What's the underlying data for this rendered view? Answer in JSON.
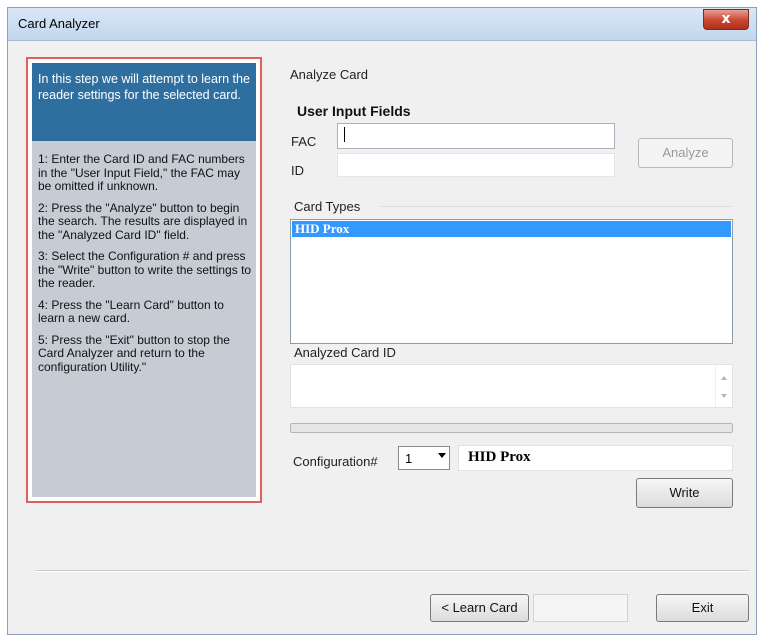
{
  "window": {
    "title": "Card Analyzer",
    "close_glyph": "x"
  },
  "help": {
    "intro": "In this step we will attempt to learn the reader settings for the selected card.",
    "steps": [
      "1: Enter the Card ID and FAC numbers in the \"User Input Field,\" the FAC may be omitted if unknown.",
      "2: Press the \"Analyze\" button to begin the search. The results are displayed in the \"Analyzed Card ID\" field.",
      "3: Select the Configuration # and press the \"Write\" button to write the settings to the reader.",
      "4: Press the \"Learn Card\" button to learn a new card.",
      "5: Press the \"Exit\" button to stop the Card Analyzer and return to the configuration Utility.\""
    ]
  },
  "main": {
    "section_title": "Analyze Card",
    "user_input_title": "User Input Fields",
    "fac_label": "FAC",
    "fac_value": "",
    "id_label": "ID",
    "id_value": "",
    "analyze_button": "Analyze",
    "card_types_label": "Card Types",
    "card_types": [
      "HID Prox"
    ],
    "analyzed_label": "Analyzed Card ID",
    "analyzed_value": "",
    "configuration_label": "Configuration#",
    "configuration_value": "1",
    "configuration_name": "HID Prox",
    "write_button": "Write"
  },
  "footer": {
    "learn_button": "< Learn Card",
    "exit_button": "Exit"
  },
  "colors": {
    "accent": "#2f6fa0",
    "selection": "#3399ff",
    "help_border": "#e06060"
  }
}
